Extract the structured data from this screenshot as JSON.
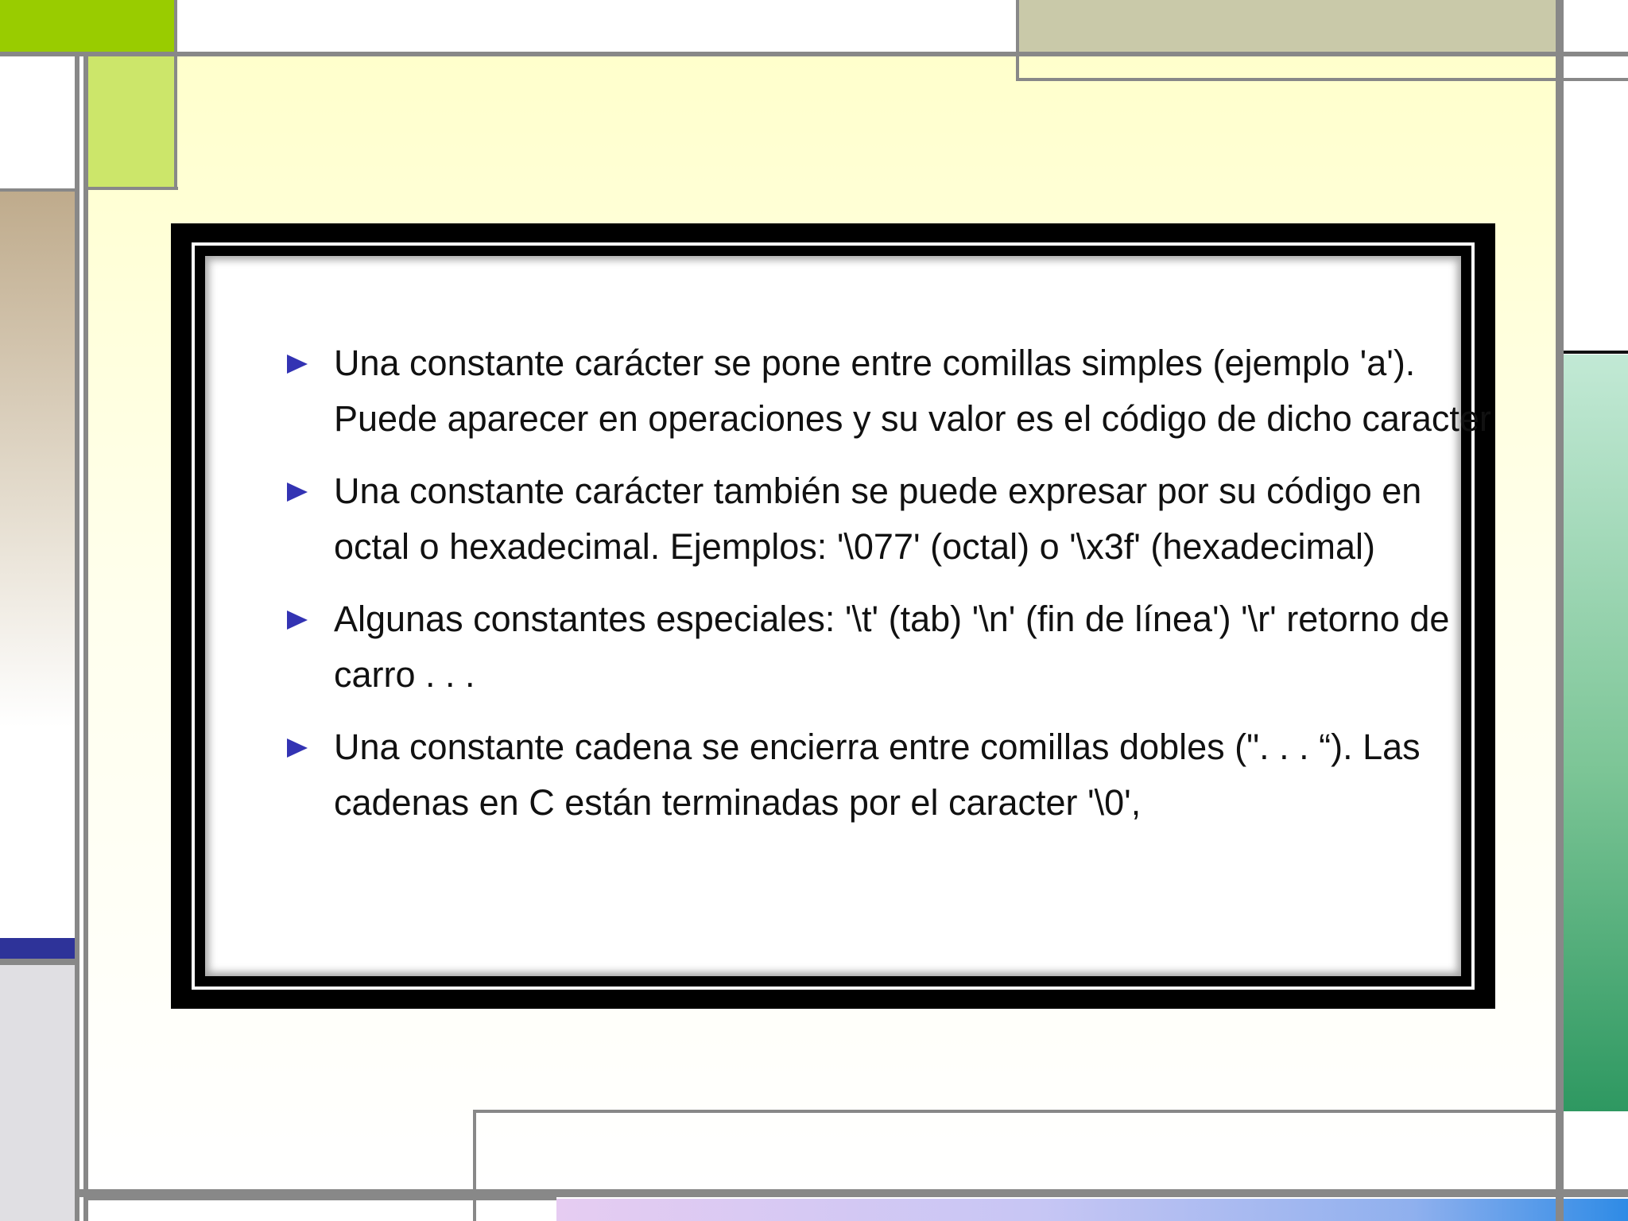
{
  "slide": {
    "bullets": [
      {
        "text": "Una constante carácter se pone entre comillas simples (ejemplo 'a'). Puede aparecer en operaciones y su valor es el código de dicho caracter"
      },
      {
        "text": "Una constante carácter también se puede expresar por su código en octal o hexadecimal. Ejemplos: '\\077' (octal) o '\\x3f' (hexadecimal)"
      },
      {
        "text": "Algunas constantes especiales: '\\t' (tab) '\\n' (fin de línea') '\\r' retorno de carro . . ."
      },
      {
        "text": "Una constante cadena se encierra entre comillas dobles (\". . . “). Las cadenas en C están terminadas por el caracter '\\0',"
      }
    ]
  },
  "colors": {
    "bullet": "#3333b3",
    "accent_green": "#99cc00",
    "frame_gray": "#888888",
    "background_yellow": "#ffffcc"
  }
}
